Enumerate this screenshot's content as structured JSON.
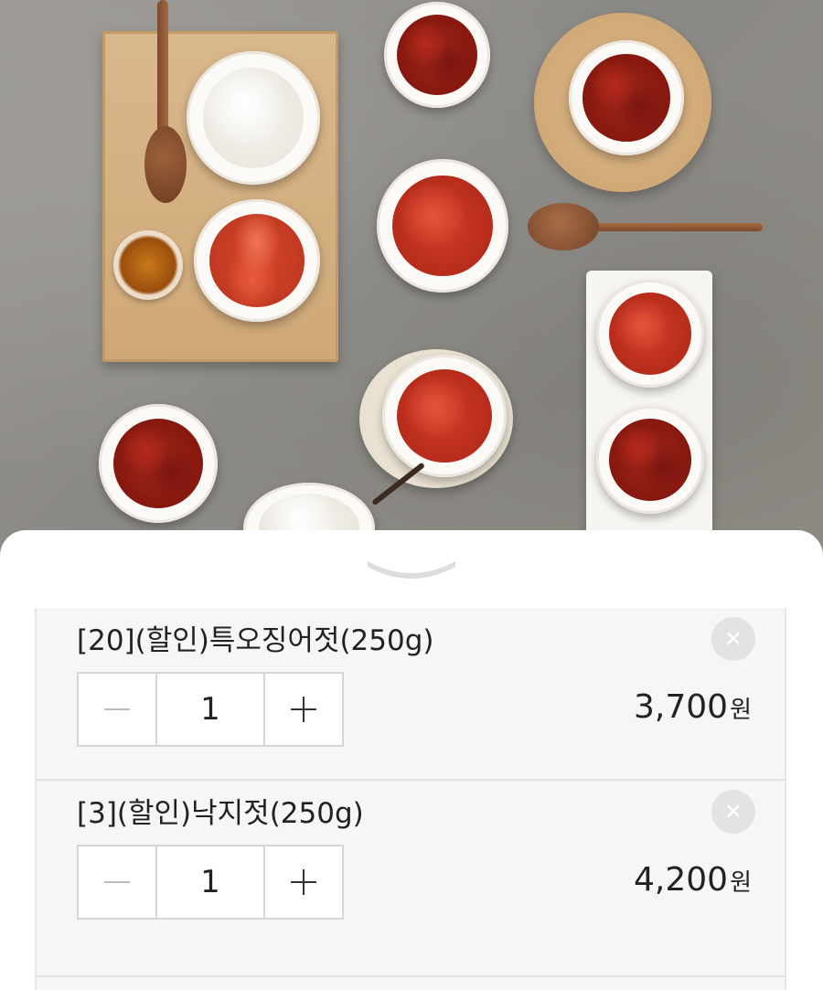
{
  "cart": {
    "items": [
      {
        "name": "[20](할인)특오징어젓(250g)",
        "quantity": "1",
        "price": "3,700",
        "currency": "원"
      },
      {
        "name": "[3](할인)낙지젓(250g)",
        "quantity": "1",
        "price": "4,200",
        "currency": "원"
      }
    ]
  },
  "icons": {
    "collapse": "chevron-down-icon",
    "remove": "close-icon",
    "decrease": "minus-icon",
    "increase": "plus-icon"
  },
  "colors": {
    "sheet_background": "#ffffff",
    "list_background": "#f6f6f6",
    "text": "#222222",
    "remove_button": "#e3e3e3",
    "stepper_border": "#d6d6d6",
    "handle": "#dddddd"
  }
}
